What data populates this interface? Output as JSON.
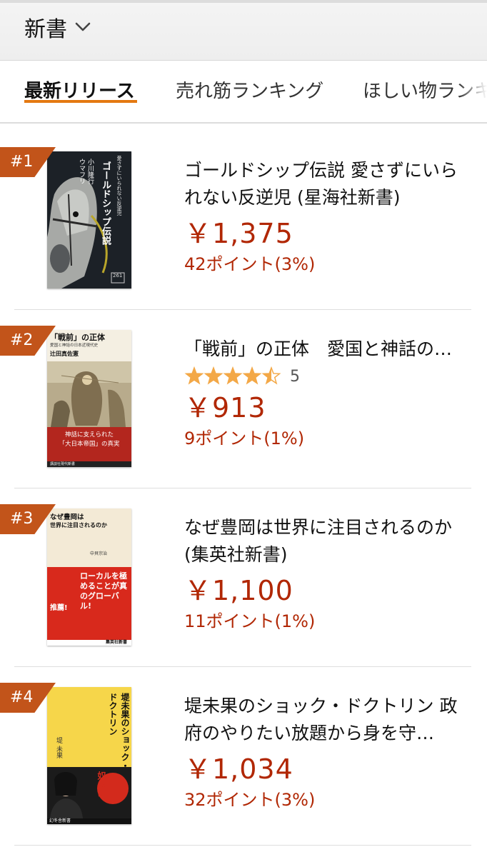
{
  "header": {
    "category_label": "新書"
  },
  "tabs": [
    {
      "label": "最新リリース"
    },
    {
      "label": "売れ筋ランキング"
    },
    {
      "label": "ほしい物ランキング"
    }
  ],
  "products": [
    {
      "rank": "#1",
      "title": "ゴールドシップ伝説 愛さずにいられない反逆児 (星海社新書)",
      "price": "￥1,375",
      "points": "42ポイント(3%)",
      "cover": {
        "texts": [
          "愛さずにいられない反逆児",
          "ゴールドシップ伝説",
          "小川隆行",
          "ウマフリ",
          "261"
        ]
      }
    },
    {
      "rank": "#2",
      "title": "「戦前」の正体　愛国と神話の…",
      "rating": 4.5,
      "rating_count": "5",
      "price": "￥913",
      "points": "9ポイント(1%)",
      "cover": {
        "texts": [
          "「戦前」の正体",
          "愛国と神話の日本近現代史",
          "辻田真佐憲",
          "神話に支えられた",
          "「大日本帝国」の真実",
          "講談社現代新書"
        ]
      }
    },
    {
      "rank": "#3",
      "title": "なぜ豊岡は世界に注目されるのか (集英社新書)",
      "price": "￥1,100",
      "points": "11ポイント(1%)",
      "cover": {
        "texts": [
          "なぜ豊岡は",
          "世界に注目されるのか",
          "中貝宗治",
          "ローカルを極めることが真のグローバル!",
          "推薦!",
          "集英社新書"
        ]
      }
    },
    {
      "rank": "#4",
      "title": "堤未果のショック・ドクトリン 政府のやりたい放題から身を守…",
      "price": "￥1,034",
      "points": "32ポイント(3%)",
      "cover": {
        "texts": [
          "堤未果のショック・ドクトリン",
          "堤 未果",
          "奴らは",
          "幻冬舎新書"
        ]
      }
    }
  ],
  "colors": {
    "rank_badge": "#c2541a",
    "price": "#b12704",
    "tab_underline": "#e47911",
    "star": "#f3a847"
  }
}
